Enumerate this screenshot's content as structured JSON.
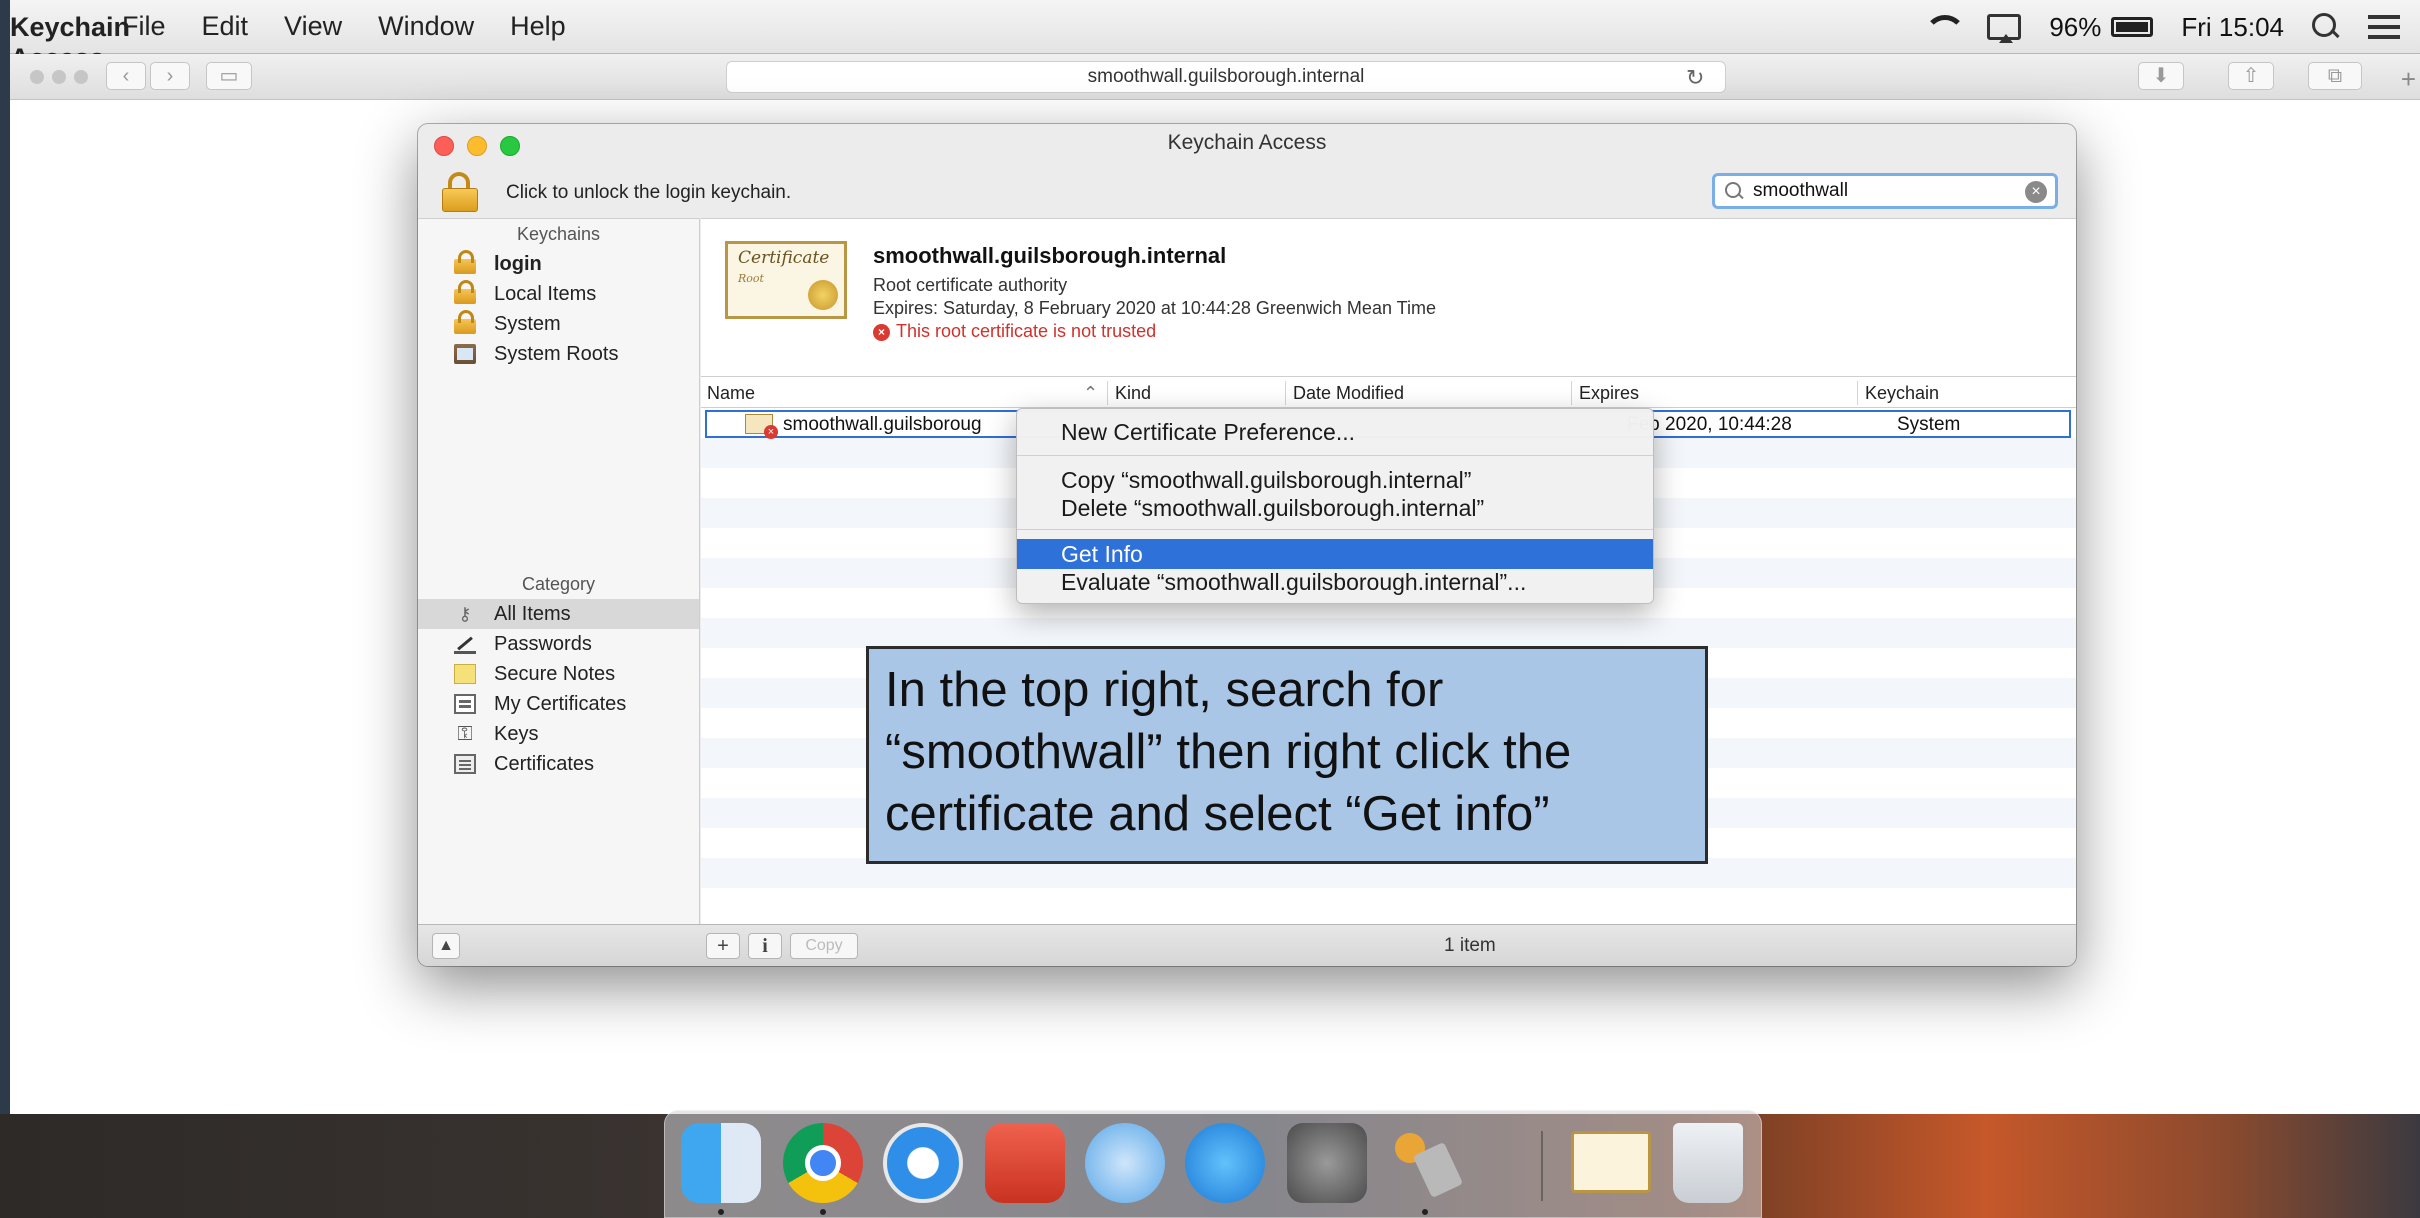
{
  "menubar": {
    "app_name": "Keychain Access",
    "menus": [
      "File",
      "Edit",
      "View",
      "Window",
      "Help"
    ],
    "battery": "96%",
    "clock": "Fri 15:04"
  },
  "browser": {
    "url": "smoothwall.guilsborough.internal"
  },
  "keychain": {
    "window_title": "Keychain Access",
    "unlock_text": "Click to unlock the login keychain.",
    "search_value": "smoothwall",
    "sidebar": {
      "keychains_header": "Keychains",
      "keychains": [
        "login",
        "Local Items",
        "System",
        "System Roots"
      ],
      "category_header": "Category",
      "categories": [
        "All Items",
        "Passwords",
        "Secure Notes",
        "My Certificates",
        "Keys",
        "Certificates"
      ]
    },
    "detail": {
      "cert_script": "Certificate",
      "cert_sub": "Root",
      "title": "smoothwall.guilsborough.internal",
      "subtitle": "Root certificate authority",
      "expires": "Expires: Saturday, 8 February 2020 at 10:44:28 Greenwich Mean Time",
      "warning": "This root certificate is not trusted"
    },
    "columns": [
      "Name",
      "Kind",
      "Date Modified",
      "Expires",
      "Keychain"
    ],
    "row": {
      "name": "smoothwall.guilsboroug",
      "expires": "Feb 2020, 10:44:28",
      "keychain": "System"
    },
    "bottom": {
      "add": "+",
      "info": "i",
      "copy": "Copy",
      "count": "1 item"
    }
  },
  "context_menu": {
    "items": [
      "New Certificate Preference...",
      "Copy “smoothwall.guilsborough.internal”",
      "Delete “smoothwall.guilsborough.internal”",
      "Get Info",
      "Evaluate “smoothwall.guilsborough.internal”..."
    ],
    "highlighted": "Get Info"
  },
  "callout": {
    "text": "In the top right, search for “smoothwall” then right click the certificate and select “Get info”"
  },
  "colors": {
    "selection_blue": "#2e71d9",
    "callout_bg": "#aac6e6",
    "warning_red": "#d0312a"
  }
}
